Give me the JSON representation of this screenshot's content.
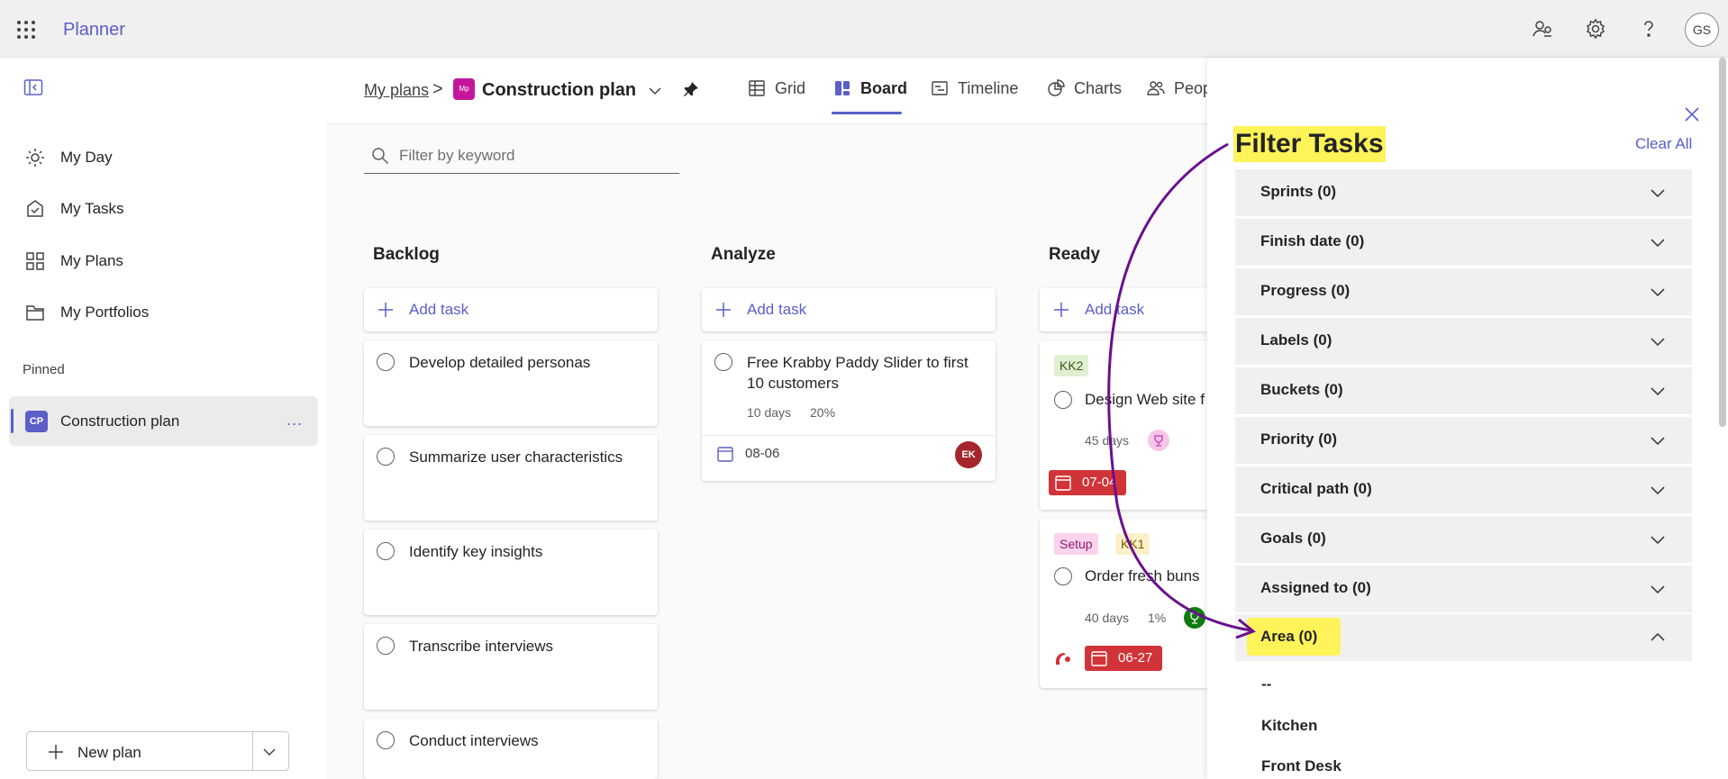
{
  "app": {
    "title": "Planner",
    "user_initials": "GS"
  },
  "topbar_icons": [
    "people-sync-icon",
    "gear-icon",
    "help-icon"
  ],
  "sidebar": {
    "items": [
      {
        "label": "My Day",
        "icon": "sun-icon"
      },
      {
        "label": "My Tasks",
        "icon": "task-check-icon"
      },
      {
        "label": "My Plans",
        "icon": "grid-icon"
      },
      {
        "label": "My Portfolios",
        "icon": "folder-icon"
      }
    ],
    "pinned_label": "Pinned",
    "pinned": {
      "badge": "CP",
      "name": "Construction plan",
      "more": "..."
    },
    "new_plan": "New plan"
  },
  "header": {
    "breadcrumb": "My plans",
    "separator": ">",
    "plan_icon": "Mp",
    "plan_title": "Construction plan",
    "tabs": [
      {
        "label": "Grid",
        "icon": "grid-icon"
      },
      {
        "label": "Board",
        "icon": "board-icon",
        "active": true
      },
      {
        "label": "Timeline",
        "icon": "timeline-icon"
      },
      {
        "label": "Charts",
        "icon": "charts-icon"
      },
      {
        "label": "Peop",
        "icon": "people-icon"
      }
    ]
  },
  "filter": {
    "placeholder": "Filter by keyword"
  },
  "board": {
    "add_task": "Add task",
    "columns": [
      {
        "title": "Backlog",
        "tasks": [
          {
            "title": "Develop detailed personas"
          },
          {
            "title": "Summarize user characteristics"
          },
          {
            "title": "Identify key insights"
          },
          {
            "title": "Transcribe interviews"
          },
          {
            "title": "Conduct interviews"
          }
        ]
      },
      {
        "title": "Analyze",
        "tasks": [
          {
            "title": "Free Krabby Paddy Slider to first 10 customers",
            "duration": "10 days",
            "progress": "20%",
            "date": "08-06",
            "assignee": "EK"
          }
        ]
      },
      {
        "title": "Ready",
        "tasks": [
          {
            "tags": [
              "KK2"
            ],
            "title": "Design Web site f",
            "duration": "45 days",
            "date": "07-04"
          },
          {
            "tags": [
              "Setup",
              "KK1"
            ],
            "title": "Order fresh buns",
            "duration": "40 days",
            "progress": "1%",
            "date": "06-27"
          }
        ]
      }
    ]
  },
  "panel": {
    "title": "Filter Tasks",
    "clear_all": "Clear All",
    "sections": [
      {
        "label": "Sprints (0)"
      },
      {
        "label": "Finish date (0)"
      },
      {
        "label": "Progress (0)"
      },
      {
        "label": "Labels (0)"
      },
      {
        "label": "Buckets (0)"
      },
      {
        "label": "Priority (0)"
      },
      {
        "label": "Critical path (0)"
      },
      {
        "label": "Goals (0)"
      },
      {
        "label": "Assigned to (0)"
      },
      {
        "label": "Area (0)",
        "expanded": true
      }
    ],
    "area_options": [
      "--",
      "Kitchen",
      "Front Desk"
    ]
  },
  "colors": {
    "accent": "#5b5fc7",
    "highlight": "#fff35a",
    "overdue": "#d13438",
    "arrow": "#6a0f8e"
  }
}
